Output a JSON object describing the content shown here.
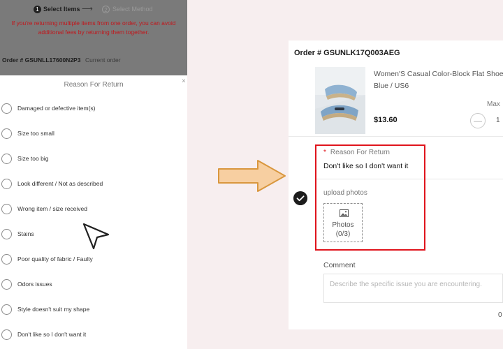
{
  "left_panel": {
    "steps": {
      "step1_number": "1",
      "step1_label": "Select Items",
      "step_arrow": "⟶",
      "step2_number": "2",
      "step2_label": "Select Method"
    },
    "notice": {
      "line1": "If you're returning multiple items from one order, you can avoid",
      "line2": "additional fees by returning them together."
    },
    "order": {
      "number": "Order # GSUNLL17600N2P3",
      "current": "Current order"
    },
    "reason_sheet": {
      "title": "Reason For Return",
      "close": "×",
      "reasons": [
        "Damaged or defective item(s)",
        "Size too small",
        "Size too big",
        "Look different / Not as described",
        "Wrong item / size received",
        "Stains",
        "Poor quality of fabric / Faulty",
        "Odors issues",
        "Style doesn't suit my shape",
        "Don't like so I don't want it"
      ]
    }
  },
  "right_card": {
    "order_number": "Order # GSUNLK17Q003AEG",
    "product": {
      "title_line1": "Women'S Casual Color-Block Flat Shoes",
      "title_line2": "Blue / US6",
      "price": "$13.60",
      "max_label": "Max",
      "qty_minus": "—",
      "qty_value": "1"
    },
    "check_icon": "check-circle-icon",
    "reason": {
      "required_mark": "*",
      "label": "Reason For Return",
      "value": "Don't like so I don't want it"
    },
    "upload": {
      "label": "upload photos",
      "photos_label": "Photos",
      "photos_count": "(0/3)"
    },
    "comment": {
      "label": "Comment",
      "placeholder": "Describe the specific issue  you are encountering.",
      "char_count": "0"
    }
  },
  "colors": {
    "accent_red": "#e0141c",
    "notice_red": "#c2161b",
    "arrow_fill": "#f7cfa1",
    "arrow_stroke": "#d9973e",
    "background": "#f7eeef"
  }
}
